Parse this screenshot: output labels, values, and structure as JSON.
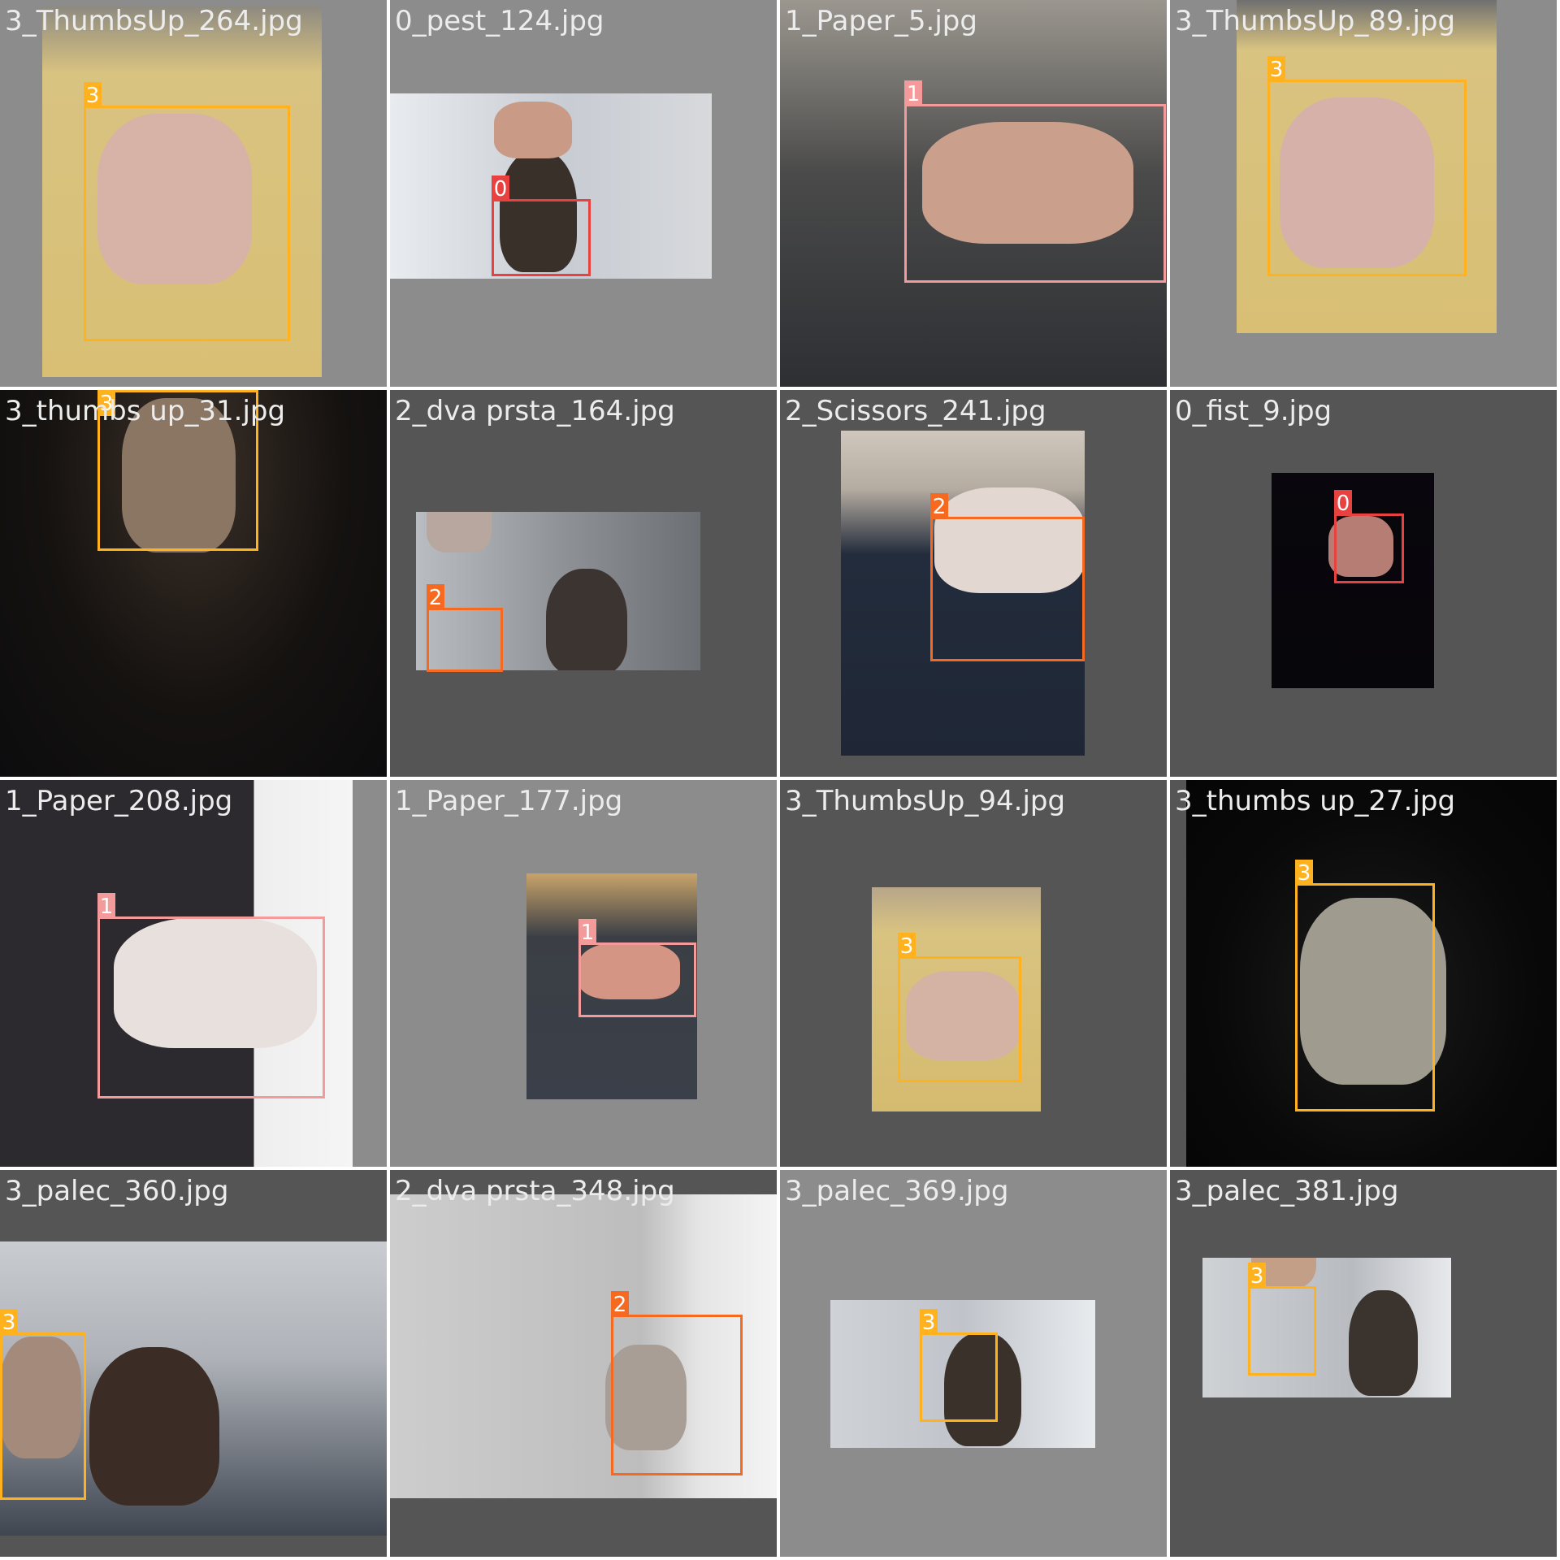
{
  "class_colors": {
    "0": "#e8413f",
    "1": "#f59a9a",
    "2": "#f56a20",
    "3": "#ffb21d"
  },
  "tiles": [
    {
      "filename": "3_ThumbsUp_264.jpg",
      "background": "#8c8c8c",
      "boxes": [
        {
          "label": "3",
          "class_id": "3"
        }
      ]
    },
    {
      "filename": "0_pest_124.jpg",
      "background": "#8c8c8c",
      "boxes": [
        {
          "label": "0",
          "class_id": "0"
        }
      ]
    },
    {
      "filename": "1_Paper_5.jpg",
      "background": "#8c8c8c",
      "boxes": [
        {
          "label": "1",
          "class_id": "1"
        }
      ]
    },
    {
      "filename": "3_ThumbsUp_89.jpg",
      "background": "#8c8c8c",
      "boxes": [
        {
          "label": "3",
          "class_id": "3"
        }
      ]
    },
    {
      "filename": "3_thumbs up_31.jpg",
      "background": "#8c8c8c",
      "boxes": [
        {
          "label": "3",
          "class_id": "3"
        }
      ]
    },
    {
      "filename": "2_dva prsta_164.jpg",
      "background": "#555555",
      "boxes": [
        {
          "label": "2",
          "class_id": "2"
        }
      ]
    },
    {
      "filename": "2_Scissors_241.jpg",
      "background": "#555555",
      "boxes": [
        {
          "label": "2",
          "class_id": "2"
        }
      ]
    },
    {
      "filename": "0_fist_9.jpg",
      "background": "#555555",
      "boxes": [
        {
          "label": "0",
          "class_id": "0"
        }
      ]
    },
    {
      "filename": "1_Paper_208.jpg",
      "background": "#8c8c8c",
      "boxes": [
        {
          "label": "1",
          "class_id": "1"
        }
      ]
    },
    {
      "filename": "1_Paper_177.jpg",
      "background": "#8c8c8c",
      "boxes": [
        {
          "label": "1",
          "class_id": "1"
        }
      ]
    },
    {
      "filename": "3_ThumbsUp_94.jpg",
      "background": "#555555",
      "boxes": [
        {
          "label": "3",
          "class_id": "3"
        }
      ]
    },
    {
      "filename": "3_thumbs up_27.jpg",
      "background": "#555555",
      "boxes": [
        {
          "label": "3",
          "class_id": "3"
        }
      ]
    },
    {
      "filename": "3_palec_360.jpg",
      "background": "#555555",
      "boxes": [
        {
          "label": "3",
          "class_id": "3"
        }
      ]
    },
    {
      "filename": "2_dva prsta_348.jpg",
      "background": "#555555",
      "boxes": [
        {
          "label": "2",
          "class_id": "2"
        }
      ]
    },
    {
      "filename": "3_palec_369.jpg",
      "background": "#8c8c8c",
      "boxes": [
        {
          "label": "3",
          "class_id": "3"
        }
      ]
    },
    {
      "filename": "3_palec_381.jpg",
      "background": "#555555",
      "boxes": [
        {
          "label": "3",
          "class_id": "3"
        }
      ]
    }
  ]
}
